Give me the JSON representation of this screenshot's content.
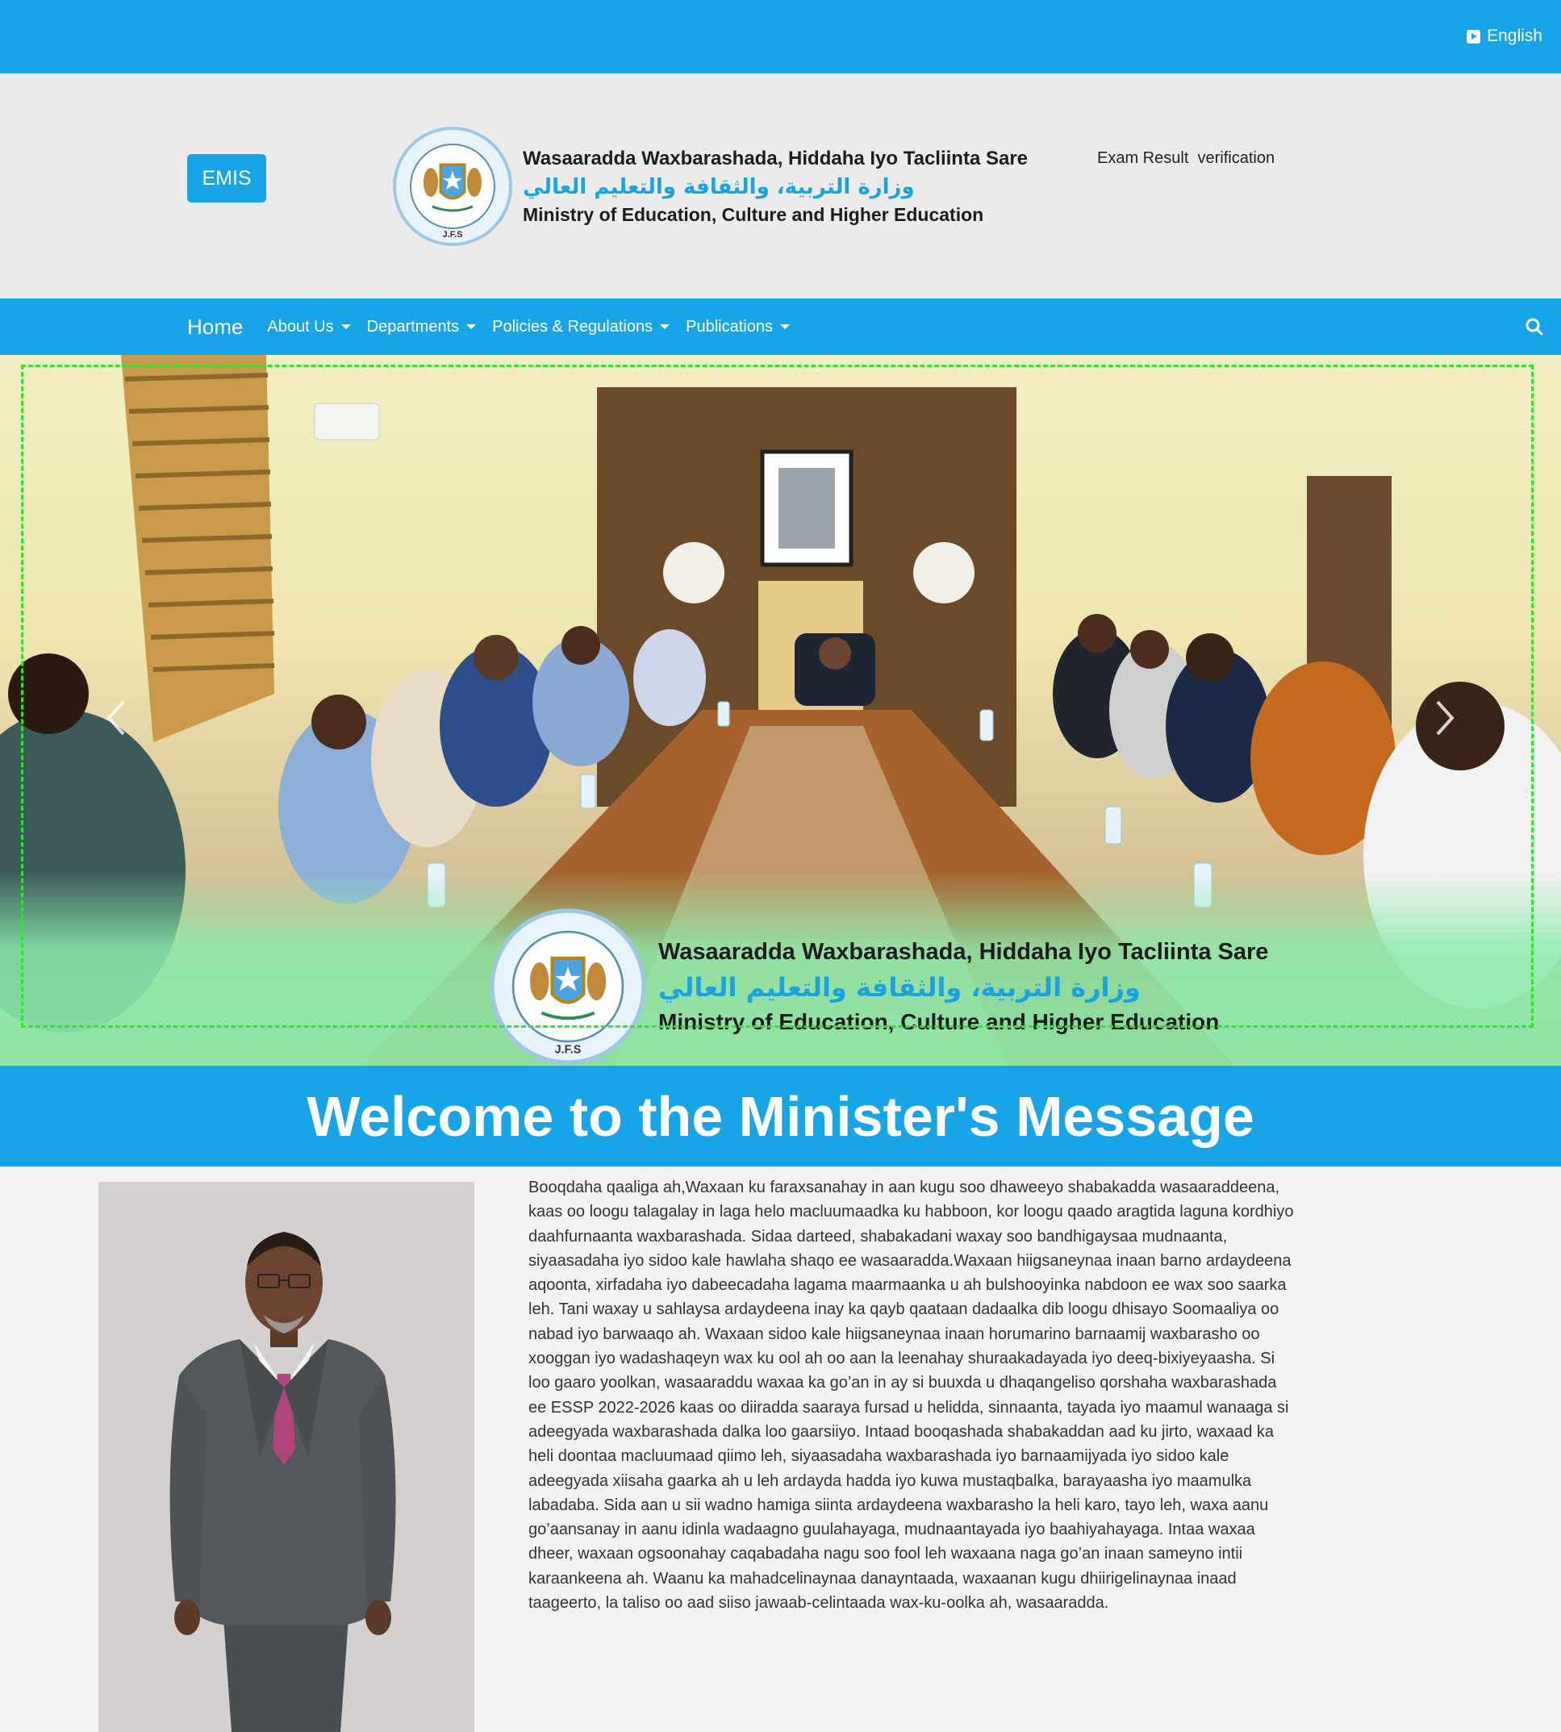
{
  "topbar": {
    "language_label": "English"
  },
  "header": {
    "emis_label": "EMIS",
    "org_name_so": "Wasaaradda Waxbarashada, Hiddaha Iyo Tacliinta Sare",
    "org_name_ar": "وزارة التربية، والثقافة والتعليم العالي",
    "org_name_en": "Ministry of Education, Culture and Higher Education",
    "exam_link": "Exam Result  verification",
    "seal_text": "J.F.S"
  },
  "nav": {
    "home": "Home",
    "items": [
      {
        "label": "About Us"
      },
      {
        "label": "Departments"
      },
      {
        "label": "Policies & Regulations"
      },
      {
        "label": "Publications"
      }
    ]
  },
  "carousel": {
    "banner_so": "Wasaaradda Waxbarashada, Hiddaha Iyo Tacliinta Sare",
    "banner_ar": "وزارة التربية، والثقافة والتعليم العالي",
    "banner_en": "Ministry of Education, Culture and Higher Education",
    "seal_text": "J.F.S"
  },
  "welcome": {
    "title": "Welcome to the Minister's Message"
  },
  "message": {
    "body": "Booqdaha qaaliga ah,Waxaan ku faraxsanahay in aan kugu soo dhaweeyo shabakadda wasaaraddeena, kaas oo loogu talagalay in laga helo macluumaadka ku habboon, kor loogu qaado aragtida laguna kordhiyo daahfurnaanta waxbarashada. Sidaa darteed, shabakadani waxay soo bandhigaysaa mudnaanta, siyaasadaha iyo sidoo kale hawlaha shaqo ee wasaaradda.Waxaan hiigsaneynaa inaan barno ardaydeena aqoonta, xirfadaha iyo dabeecadaha lagama maarmaanka u ah bulshooyinka nabdoon ee wax soo saarka leh. Tani waxay u sahlaysa ardaydeena inay ka qayb qaataan dadaalka dib loogu dhisayo Soomaaliya oo nabad iyo barwaaqo ah. Waxaan sidoo kale hiigsaneynaa inaan horumarino barnaamij waxbarasho oo xooggan iyo wadashaqeyn wax ku ool ah oo aan la leenahay shuraakadayada iyo deeq-bixiyeyaasha. Si loo gaaro yoolkan, wasaaraddu waxaa ka go’an in ay si buuxda u dhaqangeliso qorshaha waxbarashada ee ESSP 2022-2026 kaas oo diiradda saaraya fursad u helidda, sinnaanta, tayada iyo maamul wanaaga si adeegyada waxbarashada dalka loo gaarsiiyo. Intaad booqashada shabakaddan aad ku jirto, waxaad ka heli doontaa macluumaad qiimo leh, siyaasadaha waxbarashada iyo barnaamijyada iyo sidoo kale adeegyada xiisaha gaarka ah u leh ardayda hadda iyo kuwa mustaqbalka, barayaasha iyo maamulka labadaba. Sida aan u sii wadno hamiga siinta ardaydeena waxbarasho la heli karo, tayo leh, waxa aanu go’aansanay in aanu idinla wadaagno guulahayaga, mudnaantayada iyo baahiyahayaga. Intaa waxaa dheer, waxaan ogsoonahay caqabadaha nagu soo fool leh waxaana naga go’an inaan sameyno intii karaankeena ah. Waanu ka mahadcelinaynaa danayntaada, waxaanan kugu dhiirigelinaynaa inaad taageerto, la taliso oo aad siiso jawaab-celintaada wax-ku-oolka ah, wasaaradda."
  },
  "colors": {
    "primary": "#17a5e7",
    "header_bg": "#ebebeb",
    "page_bg": "#f3f3f3",
    "banner_green": "#8cebaa",
    "slide_frame": "#2ee62e"
  },
  "icons": [
    "language-play-icon",
    "search-icon",
    "chevron-left-icon",
    "chevron-right-icon",
    "caret-down-icon",
    "ministry-seal"
  ]
}
